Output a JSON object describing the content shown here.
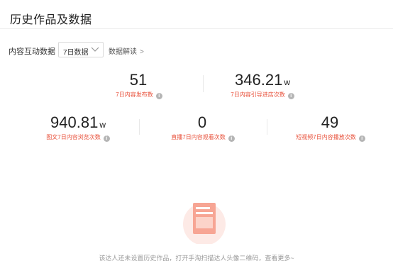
{
  "header": {
    "title": "历史作品及数据"
  },
  "filter": {
    "label": "内容互动数据",
    "select_value": "7日数据",
    "link_text": "数据解读",
    "link_arrow": ">"
  },
  "stats": [
    {
      "value": "51",
      "unit": "",
      "label": "7日内容发布数"
    },
    {
      "value": "346.21",
      "unit": "w",
      "label": "7日内容引导进店次数"
    },
    {
      "value": "940.81",
      "unit": "w",
      "label": "图文7日内容浏览次数"
    },
    {
      "value": "0",
      "unit": "",
      "label": "直播7日内容观看次数"
    },
    {
      "value": "49",
      "unit": "",
      "label": "短视频7日内容播放次数"
    }
  ],
  "empty_state": {
    "icon": "document-icon",
    "text": "该达人还未设置历史作品，打开手淘扫描达人头像二维码，查看更多~"
  },
  "colors": {
    "accent": "#e8503a",
    "muted": "#999999",
    "info_icon": "#b5b5b5"
  }
}
